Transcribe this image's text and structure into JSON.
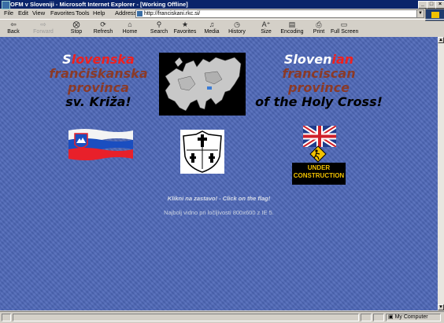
{
  "window": {
    "title": "OFM v Sloveniji - Microsoft Internet Explorer - [Working Offline]",
    "minimize": "_",
    "maximize": "□",
    "close": "×"
  },
  "menu": [
    "File",
    "Edit",
    "View",
    "Favorites",
    "Tools",
    "Help"
  ],
  "address": {
    "label": "Address",
    "url": "http://franciskani.rkc.si/"
  },
  "toolbar": [
    {
      "label": "Back",
      "icon": "back-arrow-icon",
      "enabled": true
    },
    {
      "label": "Forward",
      "icon": "forward-arrow-icon",
      "enabled": false
    },
    {
      "label": "Stop",
      "icon": "stop-icon",
      "enabled": true
    },
    {
      "label": "Refresh",
      "icon": "refresh-icon",
      "enabled": true
    },
    {
      "label": "Home",
      "icon": "home-icon",
      "enabled": true
    },
    {
      "label": "Search",
      "icon": "search-icon",
      "enabled": true
    },
    {
      "label": "Favorites",
      "icon": "favorites-icon",
      "enabled": true
    },
    {
      "label": "Media",
      "icon": "media-icon",
      "enabled": true
    },
    {
      "label": "History",
      "icon": "history-icon",
      "enabled": true
    },
    {
      "label": "Size",
      "icon": "text-size-icon",
      "enabled": true
    },
    {
      "label": "Encoding",
      "icon": "encoding-icon",
      "enabled": true
    },
    {
      "label": "Print",
      "icon": "print-icon",
      "enabled": true
    },
    {
      "label": "Full Screen",
      "icon": "full-screen-icon",
      "enabled": true
    }
  ],
  "page": {
    "left_heading": {
      "line1_first": "S",
      "line1_rest": "lovenska",
      "line2": "frančiškanska",
      "line3": "provinca",
      "line4": "sv. Križa!"
    },
    "right_heading": {
      "line1_first": "S",
      "line1_mid": "loven",
      "line1_rest": "ian",
      "line2": "franciscan",
      "line3": "province",
      "line4": "of the Holy Cross!"
    },
    "under_construction": {
      "line1": "UNDER",
      "line2": "CONSTRUCTION"
    },
    "click_flag": "Klikni na zastavo! - Click on the flag!",
    "best_viewed": "Najbolj vidno pri ločljivosti 800x600 z IE 5."
  },
  "status": {
    "zone": "My Computer"
  },
  "colors": {
    "page_background": "#4e68b8",
    "white": "#ffffff",
    "red": "#ee2020",
    "brown": "#8a3a28",
    "black": "#000000",
    "link_text": "#d8dde8"
  }
}
